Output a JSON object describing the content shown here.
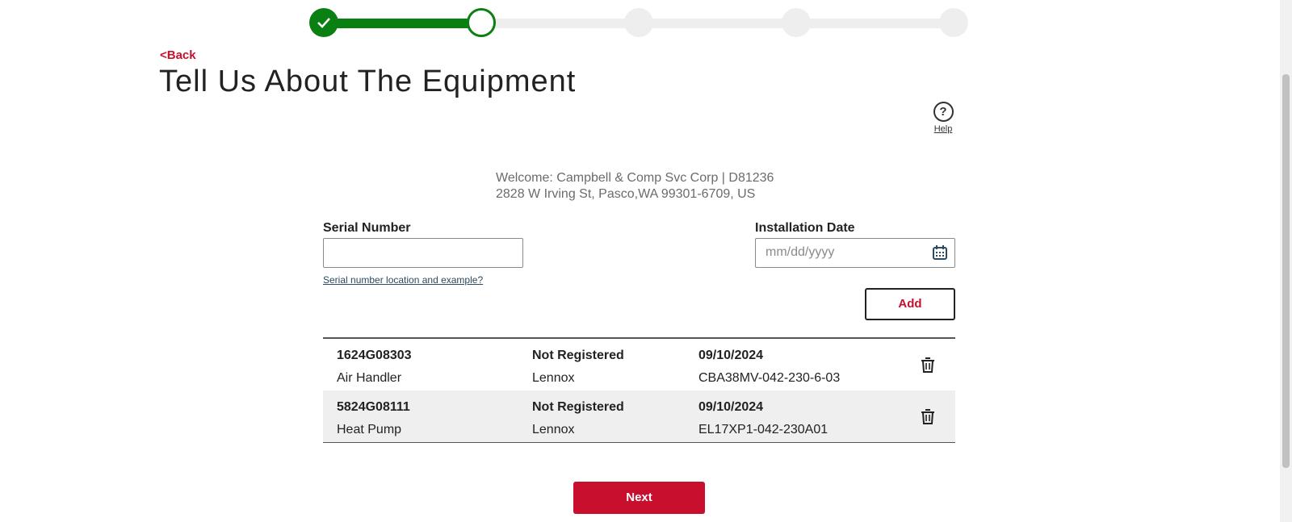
{
  "stepper": {
    "total_steps": 5,
    "completed_steps": 1,
    "current_step": 2
  },
  "nav": {
    "back_label": "<Back"
  },
  "page": {
    "title": "Tell Us About The Equipment"
  },
  "help": {
    "label": "Help",
    "icon": "question-circle-icon"
  },
  "welcome": {
    "line1": "Welcome: Campbell & Comp Svc Corp | D81236",
    "line2": "2828 W Irving St, Pasco,WA 99301-6709, US"
  },
  "form": {
    "serial_label": "Serial Number",
    "serial_value": "",
    "serial_help_link": "Serial number location and example?",
    "install_label": "Installation Date",
    "install_placeholder": "mm/dd/yyyy",
    "add_label": "Add"
  },
  "equipment": [
    {
      "serial": "1624G08303",
      "type": "Air Handler",
      "status": "Not Registered",
      "brand": "Lennox",
      "date": "09/10/2024",
      "model": "CBA38MV-042-230-6-03"
    },
    {
      "serial": "5824G08111",
      "type": "Heat Pump",
      "status": "Not Registered",
      "brand": "Lennox",
      "date": "09/10/2024",
      "model": "EL17XP1-042-230A01"
    }
  ],
  "footer": {
    "next_label": "Next"
  },
  "colors": {
    "accent": "#c8102e",
    "progress": "#0a7f12",
    "step_inactive": "#eeeeee"
  }
}
